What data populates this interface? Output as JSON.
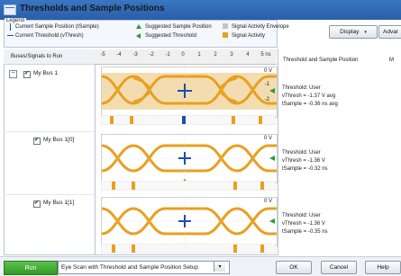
{
  "window": {
    "title": "Thresholds and Sample Positions"
  },
  "legend": {
    "title": "Legend",
    "current_sample_position": "Current Sample Position (tSample)",
    "current_threshold": "Current Threshold (vThresh)",
    "suggested_sample_position": "Suggested Sample Position",
    "suggested_threshold": "Suggested Threshold",
    "signal_activity_envelope": "Signal Activity Envelope",
    "signal_activity": "Signal Activity"
  },
  "toolbar": {
    "display_label": "Display",
    "advanced_label": "Advar"
  },
  "left_panel": {
    "header": "Buses/Signals to Run"
  },
  "buses": [
    {
      "label": "My Bus 1"
    },
    {
      "label": "My Bus 1[0]"
    },
    {
      "label": "My Bus 1[1]"
    }
  ],
  "ruler": {
    "ticks": [
      "-5",
      "-4",
      "-3",
      "-2",
      "-1",
      "0",
      "1",
      "2",
      "3",
      "4",
      "5 ns"
    ]
  },
  "right_panel": {
    "header": "Threshold and Sample Position",
    "header_cut": "M"
  },
  "scope_labels": {
    "zero": "0 V",
    "m1": "-1",
    "m2": "-2"
  },
  "info": [
    {
      "threshold": "Threshold: User",
      "vthresh": "vThresh = -1.37 V avg",
      "tsample": "tSample = -0.36 ns avg"
    },
    {
      "threshold": "Threshold: User",
      "vthresh": "vThresh = -1.36 V",
      "tsample": "tSample = -0.32 ns"
    },
    {
      "threshold": "Threshold: User",
      "vthresh": "vThresh = -1.36 V",
      "tsample": "tSample = -0.35 ns"
    }
  ],
  "bottom": {
    "run_label": "Run",
    "setup_value": "Eye Scan with Threshold and Sample Position Setup",
    "ok_label": "OK",
    "cancel_label": "Cancel",
    "help_label": "Help"
  },
  "colors": {
    "title_bar": "#2a5ea8",
    "signal": "#e8a020",
    "crosshair": "#1f4fa8",
    "suggested": "#2e9a3a",
    "run": "#2f9a25"
  }
}
